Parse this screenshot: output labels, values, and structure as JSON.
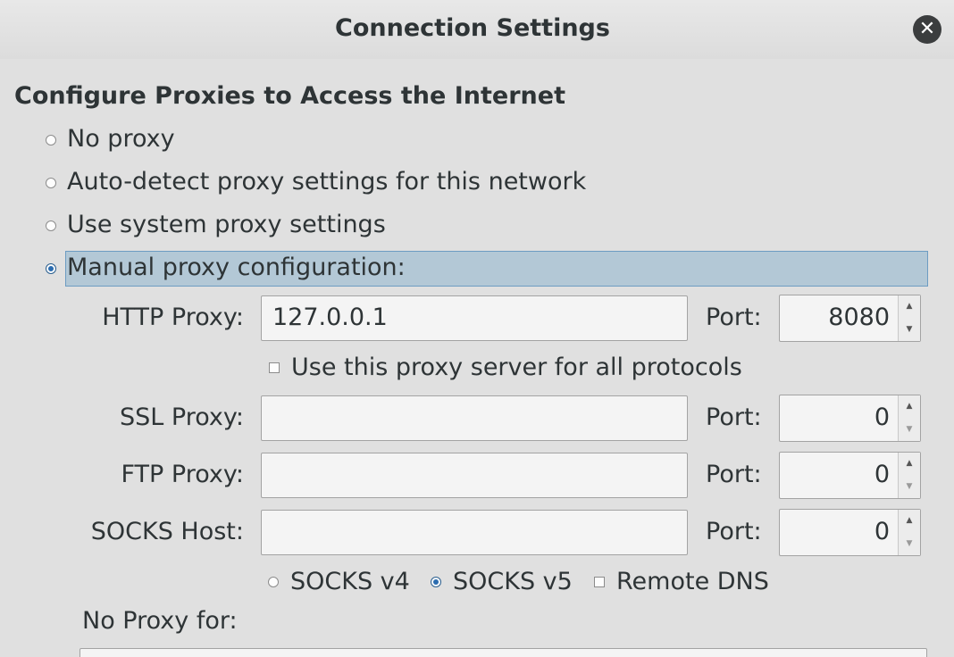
{
  "window": {
    "title": "Connection Settings"
  },
  "section_heading": "Configure Proxies to Access the Internet",
  "proxy_mode": {
    "selected": "Manual proxy configuration:",
    "options": [
      {
        "label": "No proxy",
        "checked": false
      },
      {
        "label": "Auto-detect proxy settings for this network",
        "checked": false
      },
      {
        "label": "Use system proxy settings",
        "checked": false
      },
      {
        "label": "Manual proxy configuration:",
        "checked": true
      }
    ]
  },
  "manual": {
    "http": {
      "label": "HTTP Proxy:",
      "value": "127.0.0.1",
      "port_label": "Port:",
      "port": "8080"
    },
    "share_all": {
      "label": "Use this proxy server for all protocols",
      "checked": false
    },
    "ssl": {
      "label": "SSL Proxy:",
      "value": "",
      "port_label": "Port:",
      "port": "0"
    },
    "ftp": {
      "label": "FTP Proxy:",
      "value": "",
      "port_label": "Port:",
      "port": "0"
    },
    "socks": {
      "label": "SOCKS Host:",
      "value": "",
      "port_label": "Port:",
      "port": "0"
    },
    "socks_version": {
      "v4_label": "SOCKS v4",
      "v5_label": "SOCKS v5",
      "selected": "SOCKS v5"
    },
    "remote_dns": {
      "label": "Remote DNS",
      "checked": false
    }
  },
  "no_proxy_for": {
    "label": "No Proxy for:",
    "value": ""
  },
  "colors": {
    "background": "#e0e0e0",
    "selection": "#b3c8d6",
    "selection_border": "#6d9cc2",
    "radio_dot": "#2b6cb0"
  },
  "icons": {
    "close": "close-icon",
    "spin_up": "chevron-up-icon",
    "spin_down": "chevron-down-icon"
  }
}
